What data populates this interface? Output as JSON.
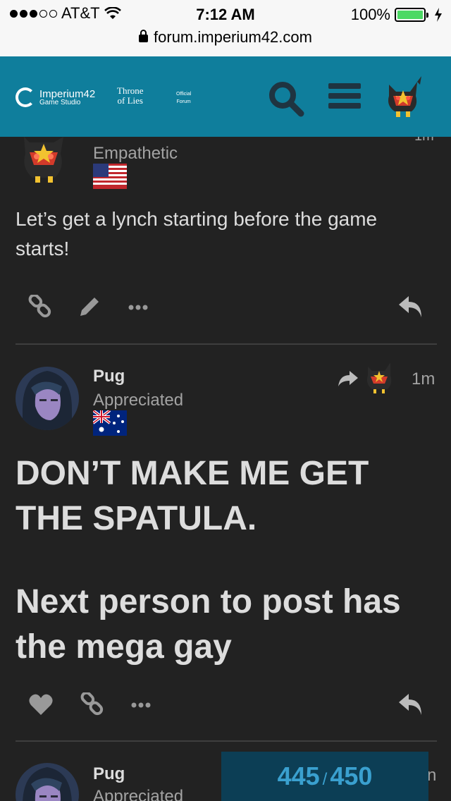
{
  "status_bar": {
    "carrier": "AT&T",
    "time": "7:12 AM",
    "battery": "100%",
    "url": "forum.imperium42.com"
  },
  "header": {
    "studio_name": "Imperium42",
    "studio_sub": "Game Studio",
    "game_line1": "Throne",
    "game_line2": "of Lies",
    "official_line1": "Official",
    "official_line2": "Forum"
  },
  "posts": [
    {
      "user_title": "Empathetic",
      "body": "Let’s get a lynch starting before the game starts!",
      "time_partial": "1m"
    },
    {
      "username": "Pug",
      "user_title": "Appreciated",
      "time": "1m",
      "body_line1": "DON’T MAKE ME GET THE SPATULA.",
      "body_line2": "Next person to post has the mega gay"
    },
    {
      "username": "Pug",
      "user_title": "Appreciated",
      "time_partial": "n"
    }
  ],
  "timeline": {
    "current": "445",
    "separator": "/",
    "total": "450"
  },
  "colors": {
    "header_bg": "#0f7e9c",
    "page_bg": "#222222",
    "timeline_bg": "#0c3e55",
    "timeline_text": "#3aa0cf"
  }
}
